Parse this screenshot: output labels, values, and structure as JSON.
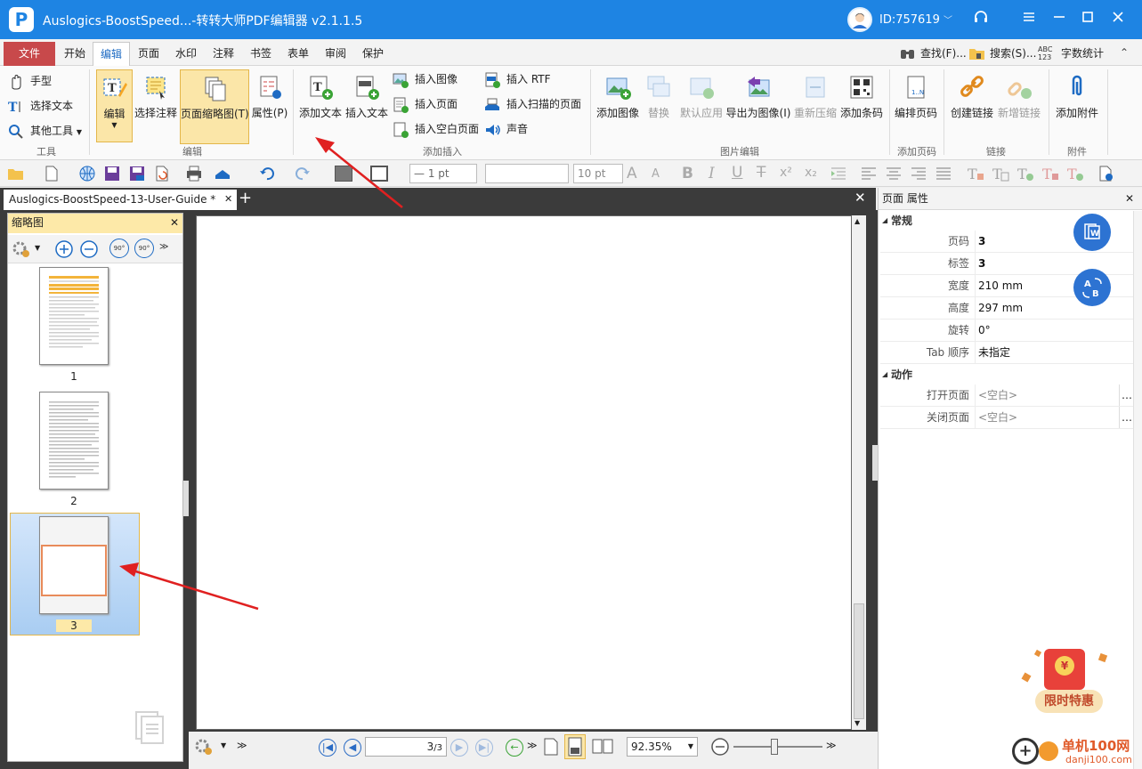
{
  "window": {
    "logo_letter": "P",
    "title": "Auslogics-BoostSpeed...-转转大师PDF编辑器 v2.1.1.5",
    "user_id": "ID:757619",
    "user_id_chevron": "﹀"
  },
  "menu": {
    "tabs": [
      "文件",
      "开始",
      "编辑",
      "页面",
      "水印",
      "注释",
      "书签",
      "表单",
      "审阅",
      "保护"
    ],
    "active_index": 2,
    "right_items": [
      "查找(F)...",
      "搜索(S)...",
      "字数统计"
    ],
    "right_abc": "ABC 123",
    "collapse_glyph": "⌃"
  },
  "ribbon": {
    "tools_group": {
      "items": [
        "手型",
        "选择文本",
        "其他工具"
      ],
      "label": "工具"
    },
    "edit_group": {
      "buttons": [
        "编辑",
        "选择注释",
        "页面缩略图(T)",
        "属性(P)"
      ],
      "label": "编辑"
    },
    "insert_group": {
      "big_buttons": [
        "添加文本",
        "插入文本"
      ],
      "small_col1": [
        "插入图像",
        "插入页面",
        "插入空白页面"
      ],
      "small_col2": [
        "插入 RTF",
        "插入扫描的页面",
        "声音"
      ],
      "label": "添加插入"
    },
    "image_group": {
      "buttons": [
        "添加图像",
        "替换",
        "默认应用",
        "导出为图像(I)",
        "重新压缩",
        "添加条码"
      ],
      "label": "图片编辑"
    },
    "pagenum_group": {
      "buttons": [
        "编排页码"
      ],
      "label": "添加页码"
    },
    "link_group": {
      "buttons": [
        "创建链接",
        "新增链接"
      ],
      "label": "链接"
    },
    "attach_group": {
      "buttons": [
        "添加附件"
      ],
      "label": "附件"
    }
  },
  "toolbar": {
    "line_width": "— 1 pt",
    "font_name": "",
    "font_size": "10 pt",
    "text_style_glyphs": [
      "A",
      "A",
      "B",
      "I",
      "U",
      "T",
      "x²",
      "x₂"
    ]
  },
  "document": {
    "tab_title": "Auslogics-BoostSpeed-13-User-Guide *",
    "close_glyph": "✕",
    "add_glyph": "+"
  },
  "thumbnails": {
    "panel_title": "缩略图",
    "close_glyph": "✕",
    "pages": [
      "1",
      "2",
      "3"
    ],
    "selected": "3",
    "rotate_left": "90°",
    "rotate_right": "90°"
  },
  "navigation": {
    "page_input": "3",
    "page_total": "/3",
    "zoom": "92.35%"
  },
  "properties": {
    "panel_title": "页面 属性",
    "close_glyph": "✕",
    "sections": [
      {
        "title": "常规",
        "rows": [
          {
            "name": "页码",
            "value": "3"
          },
          {
            "name": "标签",
            "value": "3"
          },
          {
            "name": "宽度",
            "value": "210 mm"
          },
          {
            "name": "高度",
            "value": "297 mm"
          },
          {
            "name": "旋转",
            "value": "0°"
          },
          {
            "name": "Tab 顺序",
            "value": "未指定"
          }
        ]
      },
      {
        "title": "动作",
        "rows": [
          {
            "name": "打开页面",
            "value": "<空白>"
          },
          {
            "name": "关闭页面",
            "value": "<空白>"
          }
        ]
      }
    ],
    "more_glyph": "…"
  },
  "promo": {
    "label": "限时特惠",
    "currency": "¥"
  },
  "watermark": {
    "site": "单机100网",
    "url": "danji100.com"
  },
  "colors": {
    "titlebar": "#1e84e3",
    "file_tab": "#c8494b",
    "highlight": "#fbe6a8",
    "arrow": "#e02020",
    "float_button": "#2d73d2"
  }
}
